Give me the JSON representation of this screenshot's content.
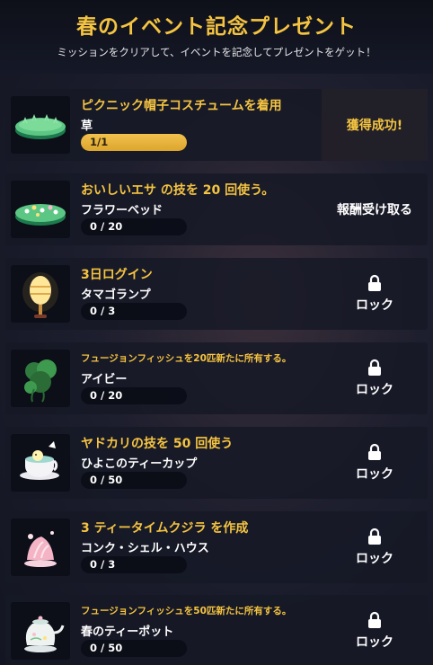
{
  "header": {
    "title": "春のイベント記念プレゼント",
    "subtitle": "ミッションをクリアして、イベントを記念してプレゼントをゲット！"
  },
  "colors": {
    "accent": "#f5c441",
    "row_bg": "#161826",
    "text": "#ffffff"
  },
  "missions": [
    {
      "mission": "ピクニック帽子コスチュームを着用",
      "reward": "草",
      "progress": "1/1",
      "progress_fraction": 1.0,
      "status": "獲得成功!",
      "state": "completed",
      "icon": "grass-patch-icon"
    },
    {
      "mission": "おいしいエサ の技を 20 回使う。",
      "reward": "フラワーベッド",
      "progress": "0 / 20",
      "progress_fraction": 0.0,
      "status": "報酬受け取る",
      "state": "claimable",
      "icon": "flower-bed-icon"
    },
    {
      "mission": "3日ログイン",
      "reward": "タマゴランプ",
      "progress": "0 / 3",
      "progress_fraction": 0.0,
      "status": "ロック",
      "state": "locked",
      "icon": "egg-lamp-icon"
    },
    {
      "mission": "フュージョンフィッシュを20匹新たに所有する。",
      "reward": "アイビー",
      "progress": "0 / 20",
      "progress_fraction": 0.0,
      "status": "ロック",
      "state": "locked",
      "icon": "ivy-plant-icon"
    },
    {
      "mission": "ヤドカリの技を 50 回使う",
      "reward": "ひよこのティーカップ",
      "progress": "0 / 50",
      "progress_fraction": 0.0,
      "status": "ロック",
      "state": "locked",
      "icon": "chick-teacup-icon"
    },
    {
      "mission": "3 ティータイムクジラ を作成",
      "reward": "コンク・シェル・ハウス",
      "progress": "0 / 3",
      "progress_fraction": 0.0,
      "status": "ロック",
      "state": "locked",
      "icon": "conch-shell-house-icon"
    },
    {
      "mission": "フュージョンフィッシュを50匹新たに所有する。",
      "reward": "春のティーポット",
      "progress": "0 / 50",
      "progress_fraction": 0.0,
      "status": "ロック",
      "state": "locked",
      "icon": "spring-teapot-icon"
    }
  ]
}
